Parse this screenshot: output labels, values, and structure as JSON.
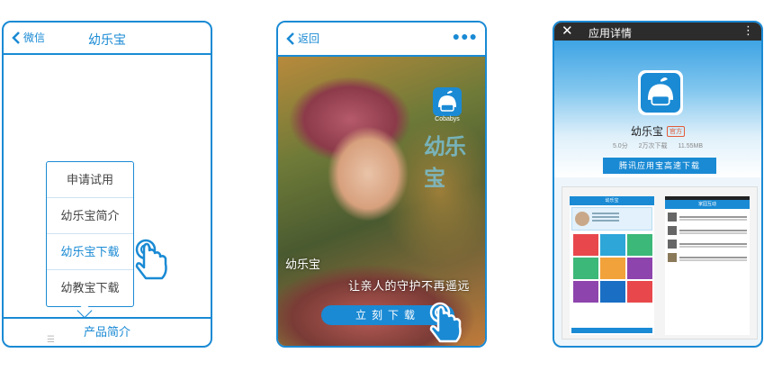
{
  "colors": {
    "accent": "#1a8ad4",
    "badge": "#e25c3b"
  },
  "phone1": {
    "back_label": "微信",
    "title": "幼乐宝",
    "menu": [
      {
        "label": "申请试用",
        "active": false
      },
      {
        "label": "幼乐宝简介",
        "active": false
      },
      {
        "label": "幼乐宝下载",
        "active": true
      },
      {
        "label": "幼教宝下载",
        "active": false
      }
    ],
    "bottom_tab": "产品简介",
    "bottom_icon": "menu-dots-icon"
  },
  "phone2": {
    "back_label": "返回",
    "more_icon": "more-dots-icon",
    "logo_text": "Cobabys",
    "brand_overlay": "幼乐宝",
    "caption_left": "幼乐宝",
    "caption_right": "让亲人的守护不再遥远",
    "download_button": "立刻下载",
    "hand_icon": "tap-hand-icon"
  },
  "phone3": {
    "close_icon": "close-icon",
    "bar_title": "应用详情",
    "more_icon": "kebab-menu-icon",
    "app_name": "幼乐宝",
    "badge": "官方",
    "rating": "5.0分",
    "downloads": "2万次下载",
    "size": "11.55MB",
    "download_button": "腾讯应用宝高速下载",
    "screenshot_a_title": "幼乐宝",
    "screenshot_b_title": "家园互动"
  }
}
